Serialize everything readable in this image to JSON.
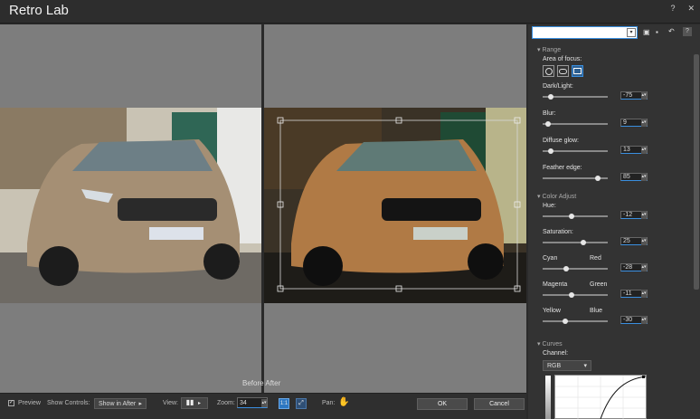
{
  "window": {
    "title": "Retro Lab"
  },
  "labels": {
    "before_after": "Before  After"
  },
  "bottom": {
    "preview_label": "Preview",
    "show_controls_label": "Show Controls:",
    "show_controls_value": "Show in After",
    "view_label": "View:",
    "zoom_label": "Zoom:",
    "zoom_value": "34",
    "pan_label": "Pan:",
    "ok": "OK",
    "cancel": "Cancel"
  },
  "panel": {
    "preset_value": "",
    "range_title": "Range",
    "area_focus_label": "Area of focus:",
    "sliders_range": [
      {
        "label": "Dark/Light:",
        "value": "-75",
        "pos": 0.12
      },
      {
        "label": "Blur:",
        "value": "9",
        "pos": 0.09
      },
      {
        "label": "Diffuse glow:",
        "value": "13",
        "pos": 0.13
      },
      {
        "label": "Feather edge:",
        "value": "85",
        "pos": 0.85
      }
    ],
    "color_title": "Color Adjust",
    "sliders_color": [
      {
        "label": "Hue:",
        "value": "-12",
        "pos": 0.44
      },
      {
        "label": "Saturation:",
        "value": "25",
        "pos": 0.62
      },
      {
        "label": "Cyan",
        "right": "Red",
        "value": "-28",
        "pos": 0.36
      },
      {
        "label": "Magenta",
        "right": "Green",
        "value": "-11",
        "pos": 0.45
      },
      {
        "label": "Yellow",
        "right": "Blue",
        "value": "-30",
        "pos": 0.35
      }
    ],
    "curves_title": "Curves",
    "channel_label": "Channel:",
    "channel_value": "RGB"
  },
  "colors": {
    "accent": "#3a8fe0",
    "panel_bg": "#333333",
    "preview_bg": "#7d7d7d"
  }
}
